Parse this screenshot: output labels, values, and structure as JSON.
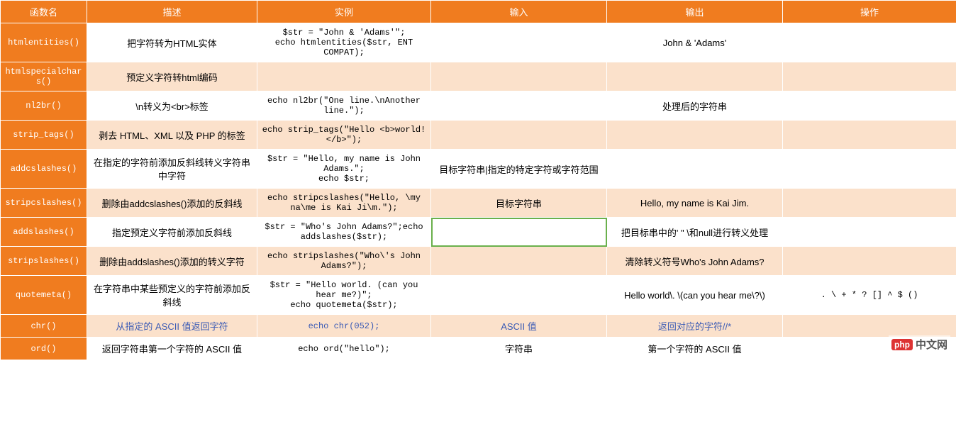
{
  "headers": [
    "函数名",
    "描述",
    "实例",
    "输入",
    "输出",
    "操作"
  ],
  "rows": [
    {
      "name": "htmlentities()",
      "desc": "把字符转为HTML实体",
      "example": "$str = \"John & 'Adams'\";\necho htmlentities($str, ENT COMPAT);",
      "input": "",
      "output": "John & 'Adams'",
      "op": "",
      "style": "a"
    },
    {
      "name": "htmlspecialchars()",
      "desc": "预定义字符转html编码",
      "example": "",
      "input": "",
      "output": "",
      "op": "",
      "style": "b"
    },
    {
      "name": "nl2br()",
      "desc": "\\n转义为<br>标签",
      "example": "echo nl2br(\"One line.\\nAnother line.\");",
      "input": "",
      "output": "处理后的字符串",
      "op": "",
      "style": "a"
    },
    {
      "name": "strip_tags()",
      "desc": "剥去 HTML、XML 以及 PHP 的标签",
      "example": "echo strip_tags(\"Hello <b>world!</b>\");",
      "input": "",
      "output": "",
      "op": "",
      "style": "b"
    },
    {
      "name": "addcslashes()",
      "desc": "在指定的字符前添加反斜线转义字符串中字符",
      "example": "$str = \"Hello, my name is John Adams.\";\necho $str;",
      "input": "目标字符串|指定的特定字符或字符范围",
      "output": "",
      "op": "",
      "style": "a"
    },
    {
      "name": "stripcslashes()",
      "desc": "删除由addcslashes()添加的反斜线",
      "example": "echo stripcslashes(\"Hello, \\my na\\me is Kai Ji\\m.\");",
      "input": "目标字符串",
      "output": "Hello, my name is Kai Jim.",
      "op": "",
      "style": "b"
    },
    {
      "name": "addslashes()",
      "desc": "指定预定义字符前添加反斜线",
      "example": "$str = \"Who's John Adams?\";echo addslashes($str);",
      "input": "",
      "output": "把目标串中的' \" \\和null进行转义处理",
      "op": "",
      "style": "a",
      "highlight_input": true
    },
    {
      "name": "stripslashes()",
      "desc": "删除由addslashes()添加的转义字符",
      "example": "echo stripslashes(\"Who\\'s John Adams?\");",
      "input": "",
      "output": "清除转义符号Who's John Adams?",
      "op": "",
      "style": "b"
    },
    {
      "name": "quotemeta()",
      "desc": "在字符串中某些预定义的字符前添加反斜线",
      "example": "$str = \"Hello world. (can you hear me?)\";\necho quotemeta($str);",
      "input": "",
      "output": "Hello world\\. \\(can you hear me\\?\\)",
      "op": ". \\ + * ? [] ^ $ ()",
      "style": "a"
    },
    {
      "name": "chr()",
      "desc": "从指定的 ASCII 值返回字符",
      "example": "echo chr(052);",
      "input": "ASCII 值",
      "output": "返回对应的字符//*",
      "op": "",
      "style": "b",
      "linkblue": true
    },
    {
      "name": "ord()",
      "desc": "返回字符串第一个字符的 ASCII 值",
      "example": "echo ord(\"hello\");",
      "input": "字符串",
      "output": "第一个字符的 ASCII 值",
      "op": "",
      "style": "a"
    }
  ],
  "watermark": {
    "badge": "php",
    "text": "中文网"
  }
}
